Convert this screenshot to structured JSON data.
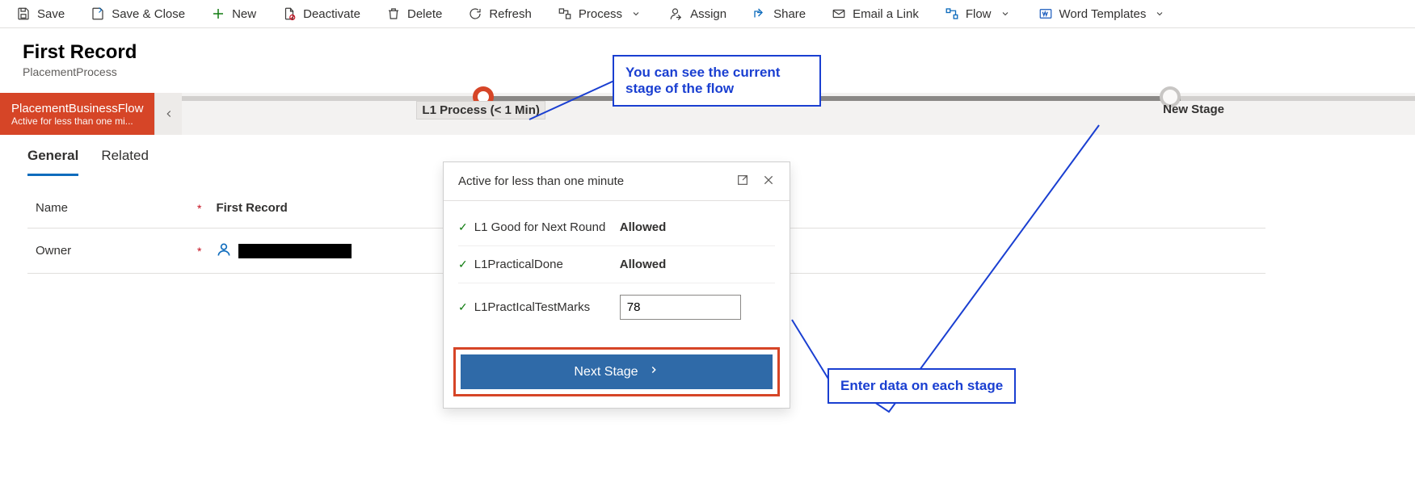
{
  "toolbar": {
    "save": "Save",
    "saveClose": "Save & Close",
    "new": "New",
    "deactivate": "Deactivate",
    "delete": "Delete",
    "refresh": "Refresh",
    "process": "Process",
    "assign": "Assign",
    "share": "Share",
    "emailLink": "Email a Link",
    "flow": "Flow",
    "wordTemplates": "Word Templates"
  },
  "header": {
    "title": "First Record",
    "subtitle": "PlacementProcess"
  },
  "bpf": {
    "name": "PlacementBusinessFlow",
    "status": "Active for less than one mi...",
    "stage1": "L1 Process  (< 1 Min)",
    "stage2": "New Stage"
  },
  "tabs": {
    "general": "General",
    "related": "Related"
  },
  "form": {
    "nameLabel": "Name",
    "nameValue": "First Record",
    "ownerLabel": "Owner"
  },
  "flyout": {
    "title": "Active for less than one minute",
    "f1Label": "L1 Good for Next Round",
    "f1Value": "Allowed",
    "f2Label": "L1PracticalDone",
    "f2Value": "Allowed",
    "f3Label": "L1PractIcalTestMarks",
    "f3Value": "78",
    "nextStage": "Next Stage"
  },
  "callouts": {
    "c1": "You can see the current stage of the flow",
    "c2": "Enter data on each stage"
  }
}
